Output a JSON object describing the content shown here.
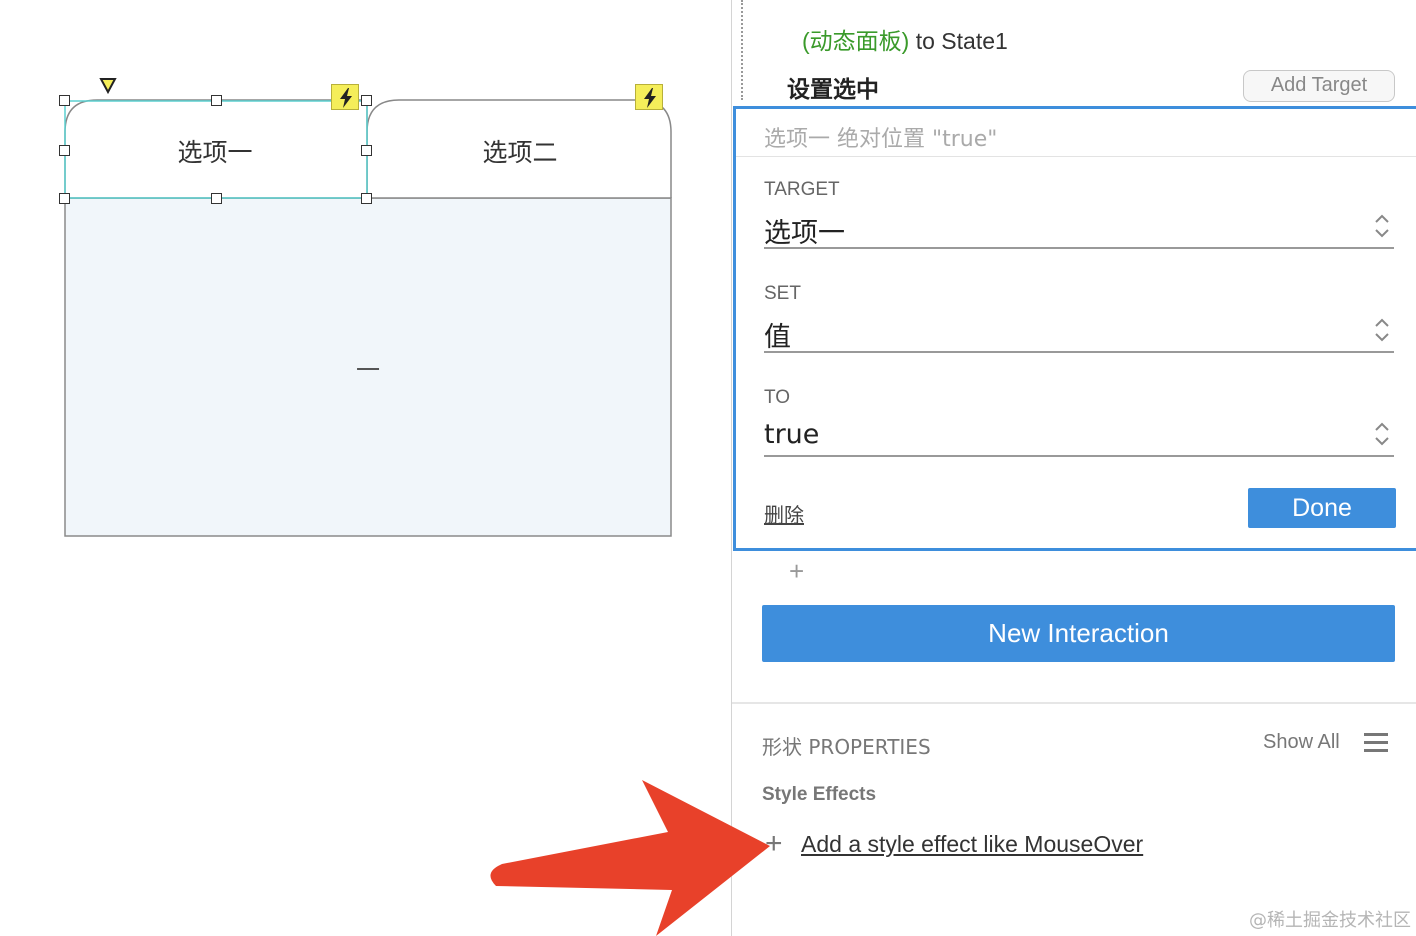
{
  "canvas": {
    "tab1_label": "选项一",
    "tab2_label": "选项二",
    "content_text": "一",
    "colors": {
      "selection": "#5bd0d0",
      "content_bg": "#f1f6fa",
      "bolt": "#f5ee5a"
    }
  },
  "panel": {
    "action_green": "(动态面板)",
    "action_rest": " to State1",
    "set_selected_title": "设置选中",
    "add_target_label": "Add Target",
    "editor": {
      "summary": "选项一 绝对位置 \"true\"",
      "target": {
        "label": "TARGET",
        "value": "选项一"
      },
      "set": {
        "label": "SET",
        "value": "值"
      },
      "to": {
        "label": "TO",
        "value": "true"
      },
      "delete_label": "删除",
      "done_label": "Done"
    },
    "plus_glyph": "+",
    "new_interaction_label": "New Interaction",
    "properties_title": "形状 PROPERTIES",
    "show_all_label": "Show All",
    "style_effects_label": "Style Effects",
    "add_effect_plus": "+",
    "add_effect_label": "Add a style effect like MouseOver",
    "watermark": "@稀土掘金技术社区",
    "colors": {
      "accent": "#3e8edc",
      "green": "#3a9a2a",
      "arrow": "#e8412a"
    }
  }
}
